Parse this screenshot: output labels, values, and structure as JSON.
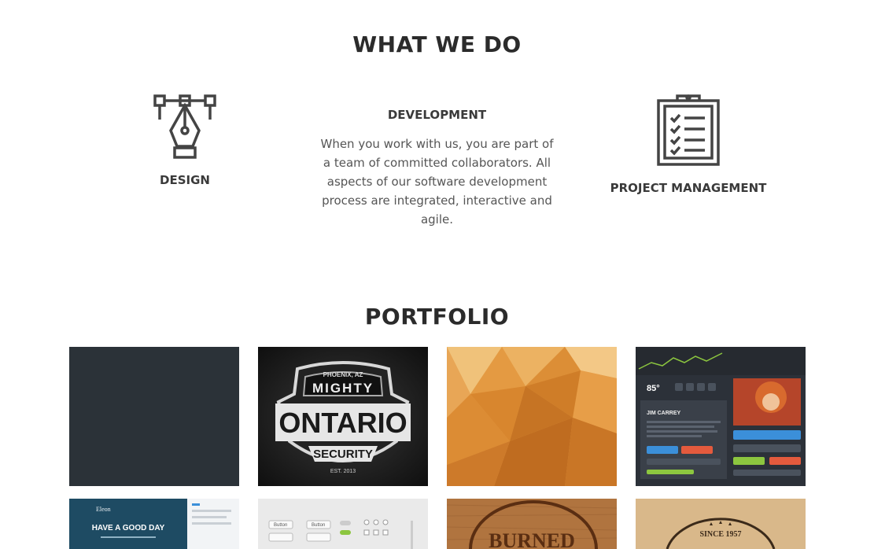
{
  "whatwedo": {
    "title": "WHAT WE DO",
    "services": [
      {
        "title": "DESIGN",
        "icon": "pen-tool-icon"
      },
      {
        "title": "DEVELOPMENT",
        "description": "When you work with us, you are part of a team of committed collaborators. All aspects of our software development process are integrated, interactive and agile."
      },
      {
        "title": "PROJECT MANAGEMENT",
        "icon": "clipboard-checklist-icon"
      }
    ]
  },
  "portfolio": {
    "title": "PORTFOLIO",
    "items": [
      {
        "name": "dark-slate"
      },
      {
        "name": "mighty-ontario-security-logo",
        "top": "PHOENIX, AZ",
        "line1": "MIGHTY",
        "line2": "ONTARIO",
        "line3": "SECURITY",
        "line4": "EST. 2013"
      },
      {
        "name": "orange-polygon-background"
      },
      {
        "name": "dark-dashboard-ui",
        "weather": "85°",
        "person": "JIM CARREY"
      },
      {
        "name": "website-template",
        "brand": "Eleon",
        "headline": "HAVE A GOOD DAY"
      },
      {
        "name": "ui-kit-buttons",
        "btn": "Button"
      },
      {
        "name": "burned-wood-stamp",
        "text": "BURNED"
      },
      {
        "name": "vintage-badge",
        "text": "SINCE 1957"
      }
    ]
  },
  "colors": {
    "accent": "#e08a2c",
    "dark": "#2b3238"
  }
}
